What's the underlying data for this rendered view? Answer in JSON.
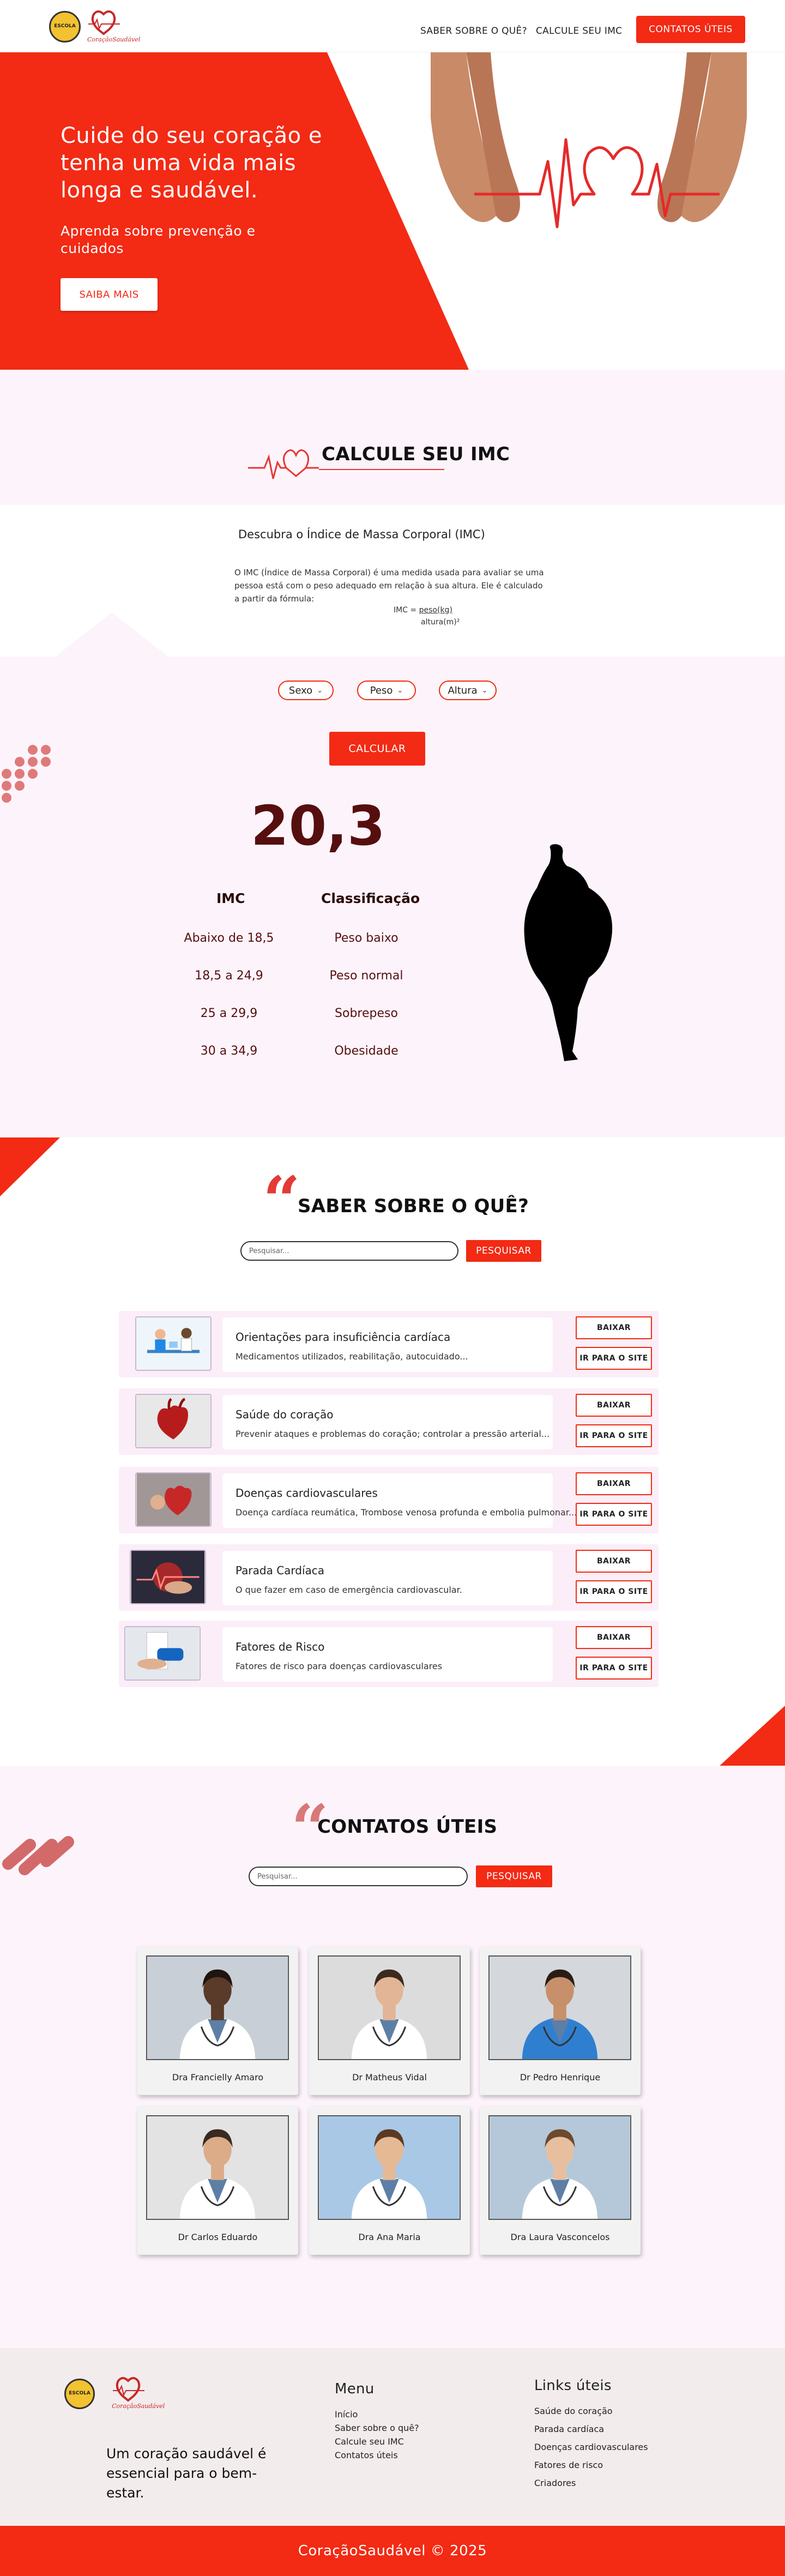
{
  "header": {
    "logo_school_text": "ESCOLA",
    "logo_brand_text": "CoraçãoSaudável",
    "nav": [
      {
        "label": "SABER SOBRE O QUÊ?"
      },
      {
        "label": "CALCULE SEU IMC"
      }
    ],
    "cta_label": "CONTATOS ÚTEIS"
  },
  "hero": {
    "title": "Cuide do seu coração e tenha uma vida mais longa e saudável.",
    "subtitle": "Aprenda sobre prevenção e cuidados",
    "button": "SAIBA MAIS"
  },
  "imc": {
    "title": "CALCULE SEU IMC",
    "subtitle": "Descubra o Índice de Massa Corporal (IMC)",
    "description": "O IMC (Índice de Massa Corporal) é uma medida usada para avaliar se uma pessoa está com o peso adequado em relação à sua altura. Ele é calculado a partir da fórmula:",
    "formula_left": "IMC =",
    "formula_num": "peso(kg)",
    "formula_den": "altura(m)²",
    "selects": [
      "Sexo",
      "Peso",
      "Altura"
    ],
    "calc_button": "CALCULAR",
    "result": "20,3",
    "table_headers": [
      "IMC",
      "Classificação"
    ],
    "table_rows": [
      [
        "Abaixo de 18,5",
        "Peso baixo"
      ],
      [
        "18,5 a 24,9",
        "Peso normal"
      ],
      [
        "25 a 29,9",
        "Sobrepeso"
      ],
      [
        "30 a 34,9",
        "Obesidade"
      ]
    ],
    "colors": {
      "accent": "#f32a14",
      "result": "#560f0f"
    }
  },
  "saber": {
    "title": "SABER SOBRE O QUÊ?",
    "search_placeholder": "Pesquisar...",
    "search_button": "PESQUISAR",
    "download_label": "BAIXAR",
    "site_label": "IR PARA O SITE",
    "cards": [
      {
        "title": "Orientações para insuficiência cardíaca",
        "desc": "Medicamentos utilizados, reabilitação, autocuidado...",
        "icon": "consultation-image"
      },
      {
        "title": "Saúde do coração",
        "desc": "Prevenir ataques e problemas do coração; controlar a pressão arterial...",
        "icon": "heart-anatomy-image"
      },
      {
        "title": "Doenças cardiovasculares",
        "desc": "Doença cardíaca reumática, Trombose venosa profunda e embolia pulmonar...",
        "icon": "heart-model-image"
      },
      {
        "title": "Parada Cardíaca",
        "desc": "O que fazer em caso de emergência cardiovascular.",
        "icon": "cardiac-monitor-image"
      },
      {
        "title": "Fatores de Risco",
        "desc": "Fatores de risco para doenças cardiovasculares",
        "icon": "blood-pressure-image"
      }
    ]
  },
  "contatos": {
    "title": "CONTATOS ÚTEIS",
    "search_placeholder": "Pesquisar...",
    "search_button": "PESQUISAR",
    "doctors": [
      {
        "name": "Dra Francielly Amaro",
        "bg": "#c9cfd6",
        "coat": "#ffffff",
        "skin": "#5a3a28",
        "hair": "#1e1410"
      },
      {
        "name": "Dr Matheus Vidal",
        "bg": "#dcdcdc",
        "coat": "#ffffff",
        "skin": "#e2b596",
        "hair": "#3b2a1e"
      },
      {
        "name": "Dr Pedro Henrique",
        "bg": "#d4d8dc",
        "coat": "#2f7fd1",
        "skin": "#c8906a",
        "hair": "#2a1c14"
      },
      {
        "name": "Dr Carlos Eduardo",
        "bg": "#e3e3e3",
        "coat": "#ffffff",
        "skin": "#dcab88",
        "hair": "#3a2a20"
      },
      {
        "name": "Dra Ana Maria",
        "bg": "#a9c8e6",
        "coat": "#ffffff",
        "skin": "#e6b995",
        "hair": "#5a3a22"
      },
      {
        "name": "Dra Laura Vasconcelos",
        "bg": "#b5c8d9",
        "coat": "#ffffff",
        "skin": "#e8bf9e",
        "hair": "#6b4a2e"
      }
    ]
  },
  "footer": {
    "menu_title": "Menu",
    "menu": [
      "Início",
      "Saber sobre o quê?",
      "Calcule seu IMC",
      "Contatos úteis"
    ],
    "links_title": "Links úteis",
    "links": [
      "Saúde do coração",
      "Parada cardíaca",
      "Doenças cardiovasculares",
      "Fatores de risco",
      "Criadores"
    ],
    "slogan": "Um coração saudável é essencial para o bem-estar.",
    "copyright": "CoraçãoSaudável © 2025"
  }
}
